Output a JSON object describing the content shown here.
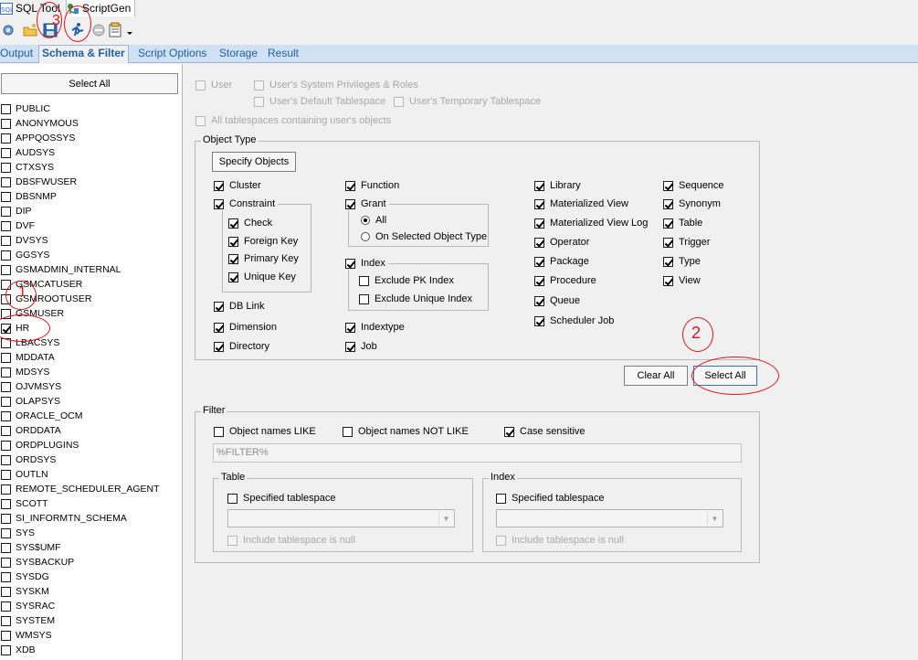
{
  "doc_tabs": {
    "sql_tool": "SQL Tool",
    "scriptgen": "ScriptGen"
  },
  "sub_tabs": [
    "Output",
    "Schema & Filter",
    "Script Options",
    "Storage",
    "Result"
  ],
  "left": {
    "select_all": "Select All",
    "users": [
      {
        "name": "PUBLIC",
        "checked": false
      },
      {
        "name": "ANONYMOUS",
        "checked": false
      },
      {
        "name": "APPQOSSYS",
        "checked": false
      },
      {
        "name": "AUDSYS",
        "checked": false
      },
      {
        "name": "CTXSYS",
        "checked": false
      },
      {
        "name": "DBSFWUSER",
        "checked": false
      },
      {
        "name": "DBSNMP",
        "checked": false
      },
      {
        "name": "DIP",
        "checked": false
      },
      {
        "name": "DVF",
        "checked": false
      },
      {
        "name": "DVSYS",
        "checked": false
      },
      {
        "name": "GGSYS",
        "checked": false
      },
      {
        "name": "GSMADMIN_INTERNAL",
        "checked": false
      },
      {
        "name": "GSMCATUSER",
        "checked": false
      },
      {
        "name": "GSMROOTUSER",
        "checked": false
      },
      {
        "name": "GSMUSER",
        "checked": false
      },
      {
        "name": "HR",
        "checked": true
      },
      {
        "name": "LBACSYS",
        "checked": false
      },
      {
        "name": "MDDATA",
        "checked": false
      },
      {
        "name": "MDSYS",
        "checked": false
      },
      {
        "name": "OJVMSYS",
        "checked": false
      },
      {
        "name": "OLAPSYS",
        "checked": false
      },
      {
        "name": "ORACLE_OCM",
        "checked": false
      },
      {
        "name": "ORDDATA",
        "checked": false
      },
      {
        "name": "ORDPLUGINS",
        "checked": false
      },
      {
        "name": "ORDSYS",
        "checked": false
      },
      {
        "name": "OUTLN",
        "checked": false
      },
      {
        "name": "REMOTE_SCHEDULER_AGENT",
        "checked": false
      },
      {
        "name": "SCOTT",
        "checked": false
      },
      {
        "name": "SI_INFORMTN_SCHEMA",
        "checked": false
      },
      {
        "name": "SYS",
        "checked": false
      },
      {
        "name": "SYS$UMF",
        "checked": false
      },
      {
        "name": "SYSBACKUP",
        "checked": false
      },
      {
        "name": "SYSDG",
        "checked": false
      },
      {
        "name": "SYSKM",
        "checked": false
      },
      {
        "name": "SYSRAC",
        "checked": false
      },
      {
        "name": "SYSTEM",
        "checked": false
      },
      {
        "name": "WMSYS",
        "checked": false
      },
      {
        "name": "XDB",
        "checked": false
      }
    ]
  },
  "user_opts": {
    "user": "User",
    "sys_priv": "User's System Privileges & Roles",
    "default_ts": "User's Default Tablespace",
    "temp_ts": "User's Temporary Tablespace",
    "all_ts": "All tablespaces containing user's objects"
  },
  "object_type": {
    "title": "Object Type",
    "specify": "Specify Objects",
    "cluster": "Cluster",
    "constraint": "Constraint",
    "check": "Check",
    "foreign_key": "Foreign Key",
    "primary_key": "Primary Key",
    "unique_key": "Unique Key",
    "db_link": "DB Link",
    "dimension": "Dimension",
    "directory": "Directory",
    "function": "Function",
    "grant": "Grant",
    "grant_all": "All",
    "grant_selected": "On Selected Object Type",
    "index": "Index",
    "excl_pk": "Exclude PK Index",
    "excl_unique": "Exclude Unique Index",
    "indextype": "Indextype",
    "job": "Job",
    "library": "Library",
    "mview": "Materialized View",
    "mview_log": "Materialized View Log",
    "operator": "Operator",
    "package": "Package",
    "procedure": "Procedure",
    "queue": "Queue",
    "scheduler_job": "Scheduler Job",
    "sequence": "Sequence",
    "synonym": "Synonym",
    "table": "Table",
    "trigger": "Trigger",
    "type": "Type",
    "view": "View",
    "clear_all": "Clear All",
    "select_all": "Select All"
  },
  "filter": {
    "title": "Filter",
    "like": "Object names LIKE",
    "not_like": "Object names NOT LIKE",
    "case_sensitive": "Case sensitive",
    "pattern": "%FILTER%",
    "table_title": "Table",
    "index_title": "Index",
    "specified_ts": "Specified tablespace",
    "include_null": "Include tablespace is null"
  },
  "annotations": {
    "mark_toolbar": "3",
    "mark_select_all": "2",
    "mark_hr": "1"
  },
  "colors": {
    "tab_bar": "#cfe1f3",
    "tab_text": "#1f5fa8",
    "annotation": "#e0141e"
  }
}
